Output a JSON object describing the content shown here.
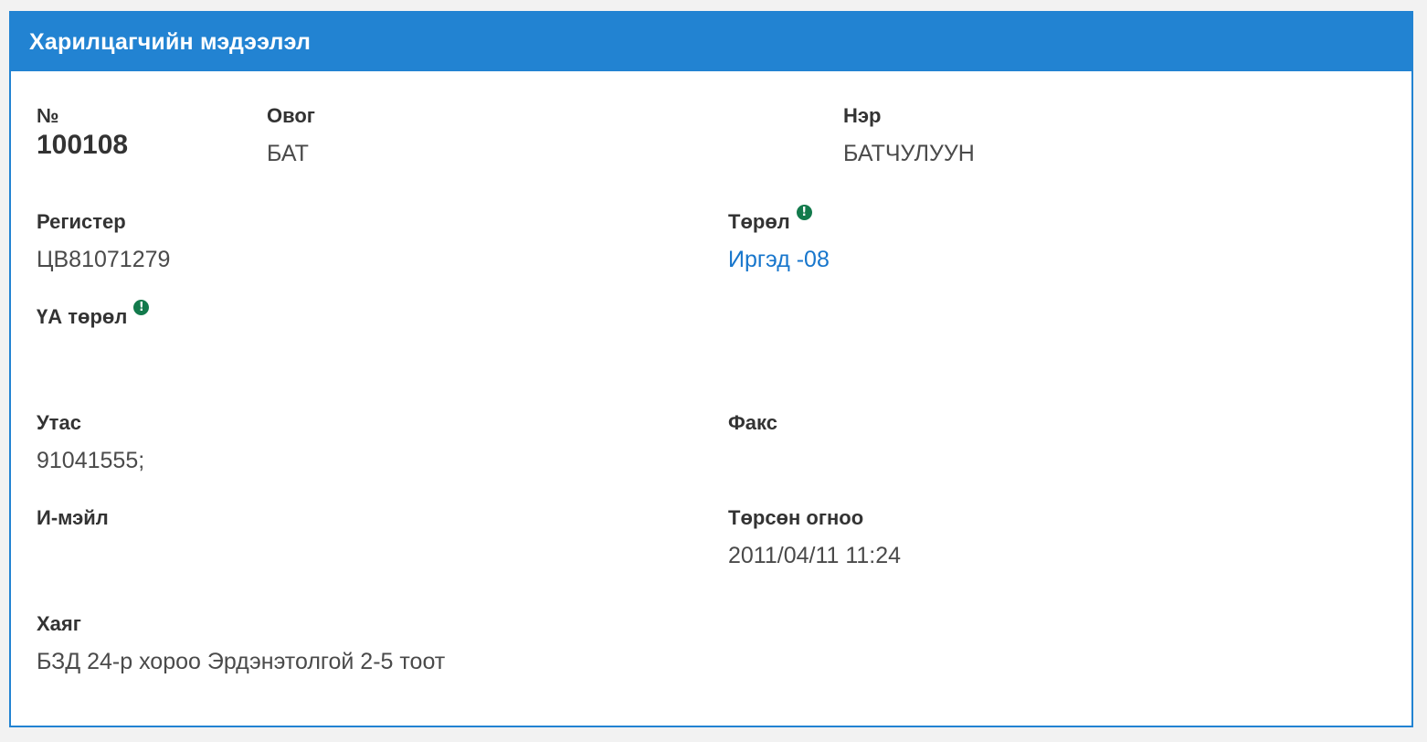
{
  "panel": {
    "title": "Харилцагчийн мэдээлэл"
  },
  "fields": {
    "number": {
      "label": "№",
      "value": "100108"
    },
    "surname": {
      "label": "Овог",
      "value": "БАТ"
    },
    "name": {
      "label": "Нэр",
      "value": "БАТЧУЛУУН"
    },
    "register": {
      "label": "Регистер",
      "value": "ЦВ81071279"
    },
    "type": {
      "label": "Төрөл",
      "value": "Иргэд -08",
      "icon": "!"
    },
    "business_type": {
      "label": "ҮА төрөл",
      "value": "",
      "icon": "!"
    },
    "phone": {
      "label": "Утас",
      "value": "91041555;"
    },
    "fax": {
      "label": "Факс",
      "value": ""
    },
    "email": {
      "label": "И-мэйл",
      "value": ""
    },
    "birth_date": {
      "label": "Төрсөн огноо",
      "value": "2011/04/11 11:24"
    },
    "address": {
      "label": "Хаяг",
      "value": "БЗД 24-р хороо Эрдэнэтолгой 2-5 тоот"
    }
  },
  "icons": {
    "info": "exclamation-circle-icon"
  },
  "colors": {
    "header_bg": "#2283d2",
    "link": "#1776cc",
    "info_icon": "#137a4c"
  }
}
